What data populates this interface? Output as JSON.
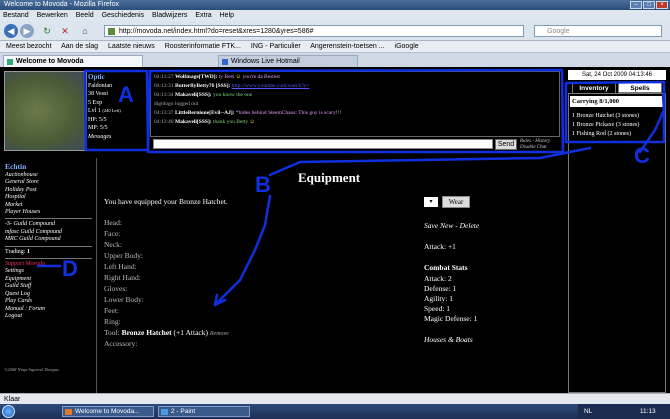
{
  "window": {
    "title": "Welcome to Movoda - Mozilla Firefox"
  },
  "menu": [
    "Bestand",
    "Bewerken",
    "Beeld",
    "Geschiedenis",
    "Bladwijzers",
    "Extra",
    "Help"
  ],
  "nav": {
    "url": "http://movoda.net/index.html?do=reset&xres=1280&yres=586#",
    "search_placeholder": "Google"
  },
  "bookmarks": [
    "Meest bezocht",
    "Aan de slag",
    "Laatste nieuws",
    "Roosterinformatie FTK...",
    "ING - Particulier",
    "Angerenstein-toetsen ...",
    "iGoogle"
  ],
  "tabs": [
    {
      "label": "Welcome to Movoda",
      "active": true
    },
    {
      "label": "Windows Live Hotmail",
      "active": false
    }
  ],
  "character": {
    "name": "Optic",
    "town": "Faldonian",
    "vessi": "38 Vessi",
    "exp": "5 Exp",
    "level": "Lvl 1",
    "level_left": "(240 Left)",
    "hp": "HP: 5/5",
    "mp": "MP: 5/5",
    "messages": "Messages"
  },
  "chat": [
    {
      "time": "04:13:27",
      "user": "Wolfmage[TWD]:",
      "text": "ty Bets",
      "suffix": "you're da Bestest",
      "style": "m2"
    },
    {
      "time": "04:13:31",
      "user": "ButterflyBetty76 [SSS]:",
      "text": "http://www.youtube.com/watch?v=",
      "suffix": "",
      "style": "link"
    },
    {
      "time": "04:13:34",
      "user": "Makaveli[SSS]:",
      "text": "you know the one",
      "suffix": "",
      "style": "m"
    },
    {
      "time": "",
      "user": "",
      "text": "digidogo logged out",
      "suffix": "",
      "style": "sys"
    },
    {
      "time": "04:13:37",
      "user": "LittleBernione[Evil--AJ]:",
      "text": "*hides behind SteemChaos: This guy is scary!!!",
      "suffix": "",
      "style": "m2"
    },
    {
      "time": "04:13:40",
      "user": "Makaveli[SSS]:",
      "text": "thank you Betty",
      "suffix": "",
      "style": "m"
    }
  ],
  "chat_send": "Send",
  "chat_rules": "Rules - History",
  "chat_disable": "Disable Chat",
  "date": "Sat, 24 Oct 2009 04:13:46",
  "inventory": {
    "tab_inventory": "Inventory",
    "tab_spells": "Spells",
    "carrying": "Carrying 8/1,000",
    "items": [
      "1 Bronze Hatchet (3 stones)",
      "1 Bronze Pickaxe (3 stones)",
      "1 Fishing Rod (2 stones)"
    ]
  },
  "sidebar": {
    "town": "Echtin",
    "links1": [
      "Auctionhouse",
      "General Store",
      "Holiday Post",
      "Hospital",
      "Market",
      "Player Houses"
    ],
    "links2": [
      "-S- Guild Compound",
      "mfasc Guild Compound",
      "MRC Guild Compound"
    ],
    "trading_label": "Trading:",
    "trading_value": "1",
    "support": "Support Movoda",
    "links3": [
      "Settings",
      "Equipment",
      "Guild Staff",
      "Quest Log",
      "Play Cards",
      "Manual : Forum",
      "Logout"
    ],
    "footer": "©2008 Ninja Squirrel Designs"
  },
  "equipment": {
    "title": "Equipment",
    "message": "You have equipped your Bronze Hatchet.",
    "slots": [
      "Head:",
      "Face:",
      "Neck:",
      "Upper Body:",
      "Left Hand:",
      "Right Hand:",
      "Gloves:",
      "Lower Body:",
      "Feet:",
      "Ring:"
    ],
    "tool_label": "Tool:",
    "tool_item": "Bronze Hatchet",
    "tool_bonus": "(+1 Attack)",
    "tool_remove": "Remove",
    "accessory": "Accessory:",
    "wear_button": "Wear",
    "save_new": "Save New - Delete",
    "attack_bonus": "Attack: +1",
    "combat_header": "Combat Stats",
    "stats": [
      "Attack: 2",
      "Defense: 1",
      "Agility: 1",
      "Speed: 1",
      "Magic Defense: 1"
    ],
    "houses": "Houses & Boats"
  },
  "annotations": [
    "A",
    "B",
    "C",
    "D"
  ],
  "annotation_color": "#1030e0",
  "status": "Klaar",
  "taskbar": {
    "items": [
      "Welcome to Movoda...",
      "2 - Paint"
    ],
    "tray_lang": "NL",
    "tray_time": "11:13"
  }
}
